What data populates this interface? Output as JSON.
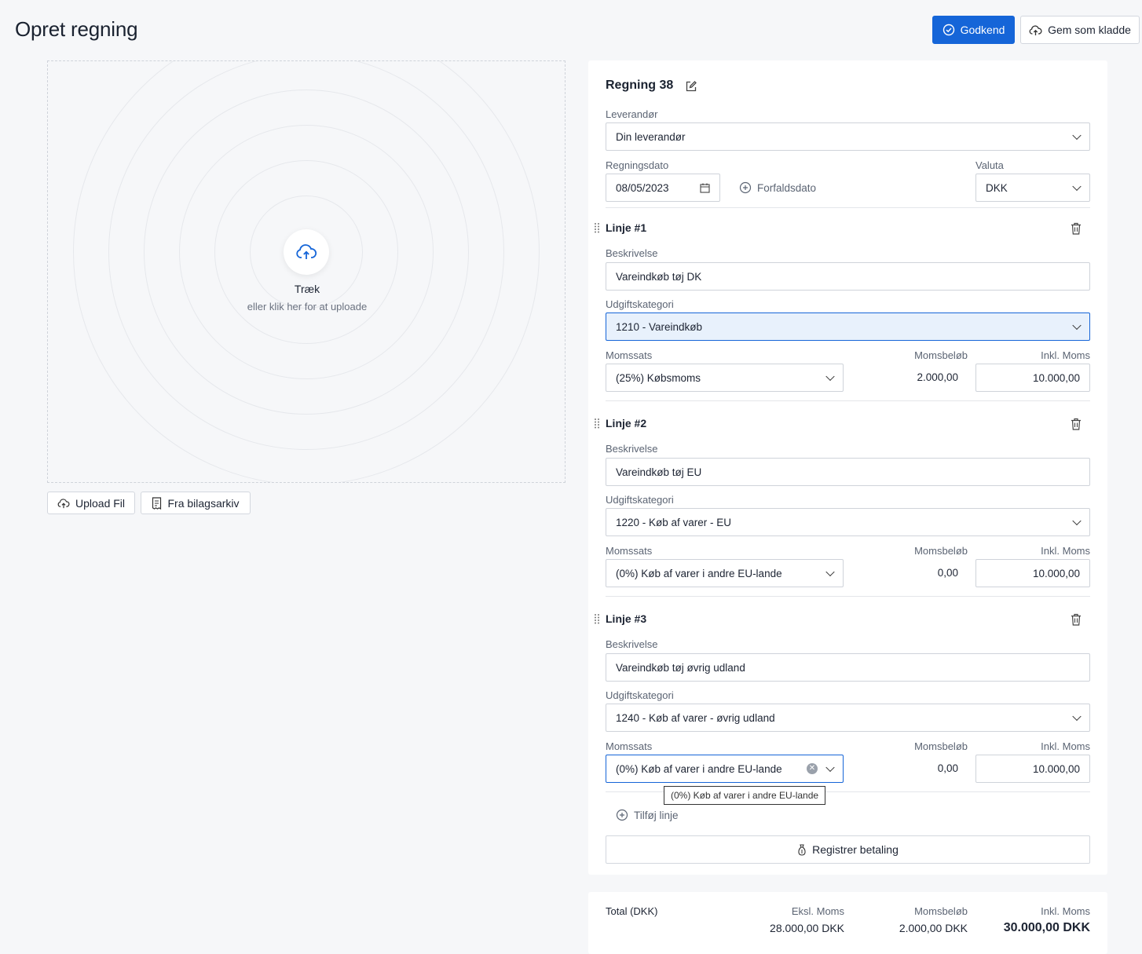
{
  "page": {
    "title": "Opret regning"
  },
  "actions": {
    "approve_label": "Godkend",
    "draft_label": "Gem som kladde"
  },
  "upload": {
    "drag_label": "Træk",
    "drag_sub": "eller klik her for at uploade",
    "upload_file_label": "Upload Fil",
    "archive_label": "Fra bilagsarkiv"
  },
  "bill": {
    "title": "Regning 38",
    "supplier_label": "Leverandør",
    "supplier_value": "Din leverandør",
    "date_label": "Regningsdato",
    "date_value": "08/05/2023",
    "due_label": "Forfaldsdato",
    "currency_label": "Valuta",
    "currency_value": "DKK"
  },
  "line_labels": {
    "description": "Beskrivelse",
    "category": "Udgiftskategori",
    "vat_rate": "Momssats",
    "vat_amount": "Momsbeløb",
    "incl_vat": "Inkl. Moms"
  },
  "lines": [
    {
      "title": "Linje #1",
      "description": "Vareindkøb tøj DK",
      "category": "1210 -  Vareindkøb",
      "vat_rate": "(25%) Købsmoms",
      "vat_amount": "2.000,00",
      "incl_vat": "10.000,00"
    },
    {
      "title": "Linje #2",
      "description": "Vareindkøb tøj EU",
      "category": "1220 -  Køb af varer - EU",
      "vat_rate": "(0%) Køb af varer i andre EU-lande",
      "vat_amount": "0,00",
      "incl_vat": "10.000,00"
    },
    {
      "title": "Linje #3",
      "description": "Vareindkøb tøj øvrig udland",
      "category": "1240 -  Køb af varer - øvrig udland",
      "vat_rate": "(0%) Køb af varer i andre EU-lande",
      "vat_amount": "0,00",
      "incl_vat": "10.000,00"
    }
  ],
  "tooltip": "(0%) Køb af varer i andre EU-lande",
  "add_line_label": "Tilføj linje",
  "register_payment_label": "Registrer betaling",
  "totals": {
    "label": "Total (DKK)",
    "excl_label": "Eksl. Moms",
    "excl_value": "28.000,00 DKK",
    "vat_label": "Momsbeløb",
    "vat_value": "2.000,00 DKK",
    "incl_label": "Inkl. Moms",
    "incl_value": "30.000,00 DKK"
  },
  "colors": {
    "primary": "#1565d8",
    "focus_bg": "#e8f1fc"
  }
}
